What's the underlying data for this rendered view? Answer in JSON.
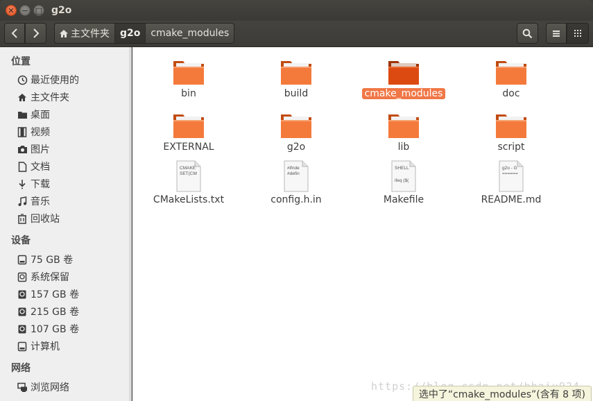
{
  "window": {
    "title": "g2o"
  },
  "toolbar": {
    "breadcrumbs": [
      {
        "label": "主文件夹",
        "icon": "home-icon"
      },
      {
        "label": "g2o"
      },
      {
        "label": "cmake_modules"
      }
    ]
  },
  "sidebar": {
    "sections": [
      {
        "heading": "位置",
        "items": [
          {
            "label": "最近使用的",
            "icon": "clock-icon"
          },
          {
            "label": "主文件夹",
            "icon": "home-icon"
          },
          {
            "label": "桌面",
            "icon": "folder-desktop-icon"
          },
          {
            "label": "视频",
            "icon": "film-icon"
          },
          {
            "label": "图片",
            "icon": "camera-icon"
          },
          {
            "label": "文档",
            "icon": "document-icon"
          },
          {
            "label": "下载",
            "icon": "download-icon"
          },
          {
            "label": "音乐",
            "icon": "music-icon"
          },
          {
            "label": "回收站",
            "icon": "trash-icon"
          }
        ]
      },
      {
        "heading": "设备",
        "items": [
          {
            "label": "75 GB 卷",
            "icon": "drive-icon"
          },
          {
            "label": "系统保留",
            "icon": "drive-icon"
          },
          {
            "label": "157 GB 卷",
            "icon": "drive-icon"
          },
          {
            "label": "215 GB 卷",
            "icon": "drive-icon"
          },
          {
            "label": "107 GB 卷",
            "icon": "drive-icon"
          },
          {
            "label": "计算机",
            "icon": "drive-icon"
          }
        ]
      },
      {
        "heading": "网络",
        "items": [
          {
            "label": "浏览网络",
            "icon": "network-icon"
          }
        ]
      }
    ]
  },
  "files": [
    {
      "name": "bin",
      "type": "folder",
      "selected": false
    },
    {
      "name": "build",
      "type": "folder",
      "selected": false
    },
    {
      "name": "cmake_modules",
      "type": "folder",
      "selected": true
    },
    {
      "name": "doc",
      "type": "folder",
      "selected": false
    },
    {
      "name": "EXTERNAL",
      "type": "folder",
      "selected": false
    },
    {
      "name": "g2o",
      "type": "folder",
      "selected": false
    },
    {
      "name": "lib",
      "type": "folder",
      "selected": false
    },
    {
      "name": "script",
      "type": "folder",
      "selected": false
    },
    {
      "name": "CMakeLists.txt",
      "type": "text",
      "preview": [
        "CMAKE",
        "SET(CM"
      ],
      "selected": false
    },
    {
      "name": "config.h.in",
      "type": "text",
      "preview": [
        "#ifnde",
        "#defin"
      ],
      "selected": false
    },
    {
      "name": "Makefile",
      "type": "text",
      "preview": [
        "SHELL",
        "",
        "ifeq ($("
      ],
      "selected": false
    },
    {
      "name": "README.md",
      "type": "text",
      "preview": [
        "g2o - G",
        "======"
      ],
      "selected": false
    }
  ],
  "status": {
    "text": "选中了“cmake_modules”(含有 8 项)"
  },
  "watermark": {
    "text": "https://blog.csdn.net/hhaiu924"
  },
  "colors": {
    "accent": "#f07746",
    "folder": "#f47a3b",
    "titlebar": "#3c3b37"
  }
}
